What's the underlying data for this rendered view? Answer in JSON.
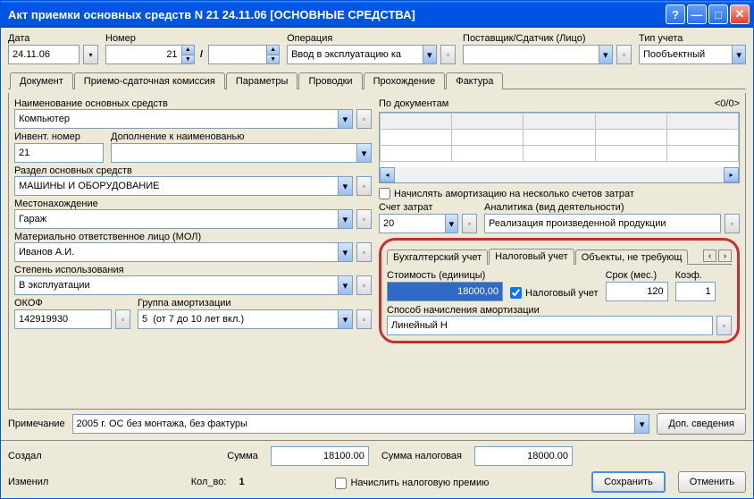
{
  "title": "Акт приемки основных средств N 21 24.11.06 [ОСНОВНЫЕ СРЕДСТВА]",
  "header": {
    "date": {
      "label": "Дата",
      "value": "24.11.06"
    },
    "number": {
      "label": "Номер",
      "value": "21",
      "sub": ""
    },
    "operation": {
      "label": "Операция",
      "value": "Ввод в эксплуатацию ка"
    },
    "supplier": {
      "label": "Поставщик/Сдатчик (Лицо)",
      "value": ""
    },
    "account_type": {
      "label": "Тип учета",
      "value": "Пообъектный"
    }
  },
  "tabs": [
    "Документ",
    "Приемо-сдаточная комиссия",
    "Параметры",
    "Проводки",
    "Прохождение",
    "Фактура"
  ],
  "active_tab": 0,
  "doc": {
    "name": {
      "label": "Наименование основных средств",
      "value": "Компьютер"
    },
    "inv": {
      "label": "Инвент. номер",
      "value": "21"
    },
    "name_add": {
      "label": "Дополнение к наименованью",
      "value": ""
    },
    "section": {
      "label": "Раздел основных средств",
      "value": "МАШИНЫ И ОБОРУДОВАНИЕ"
    },
    "location": {
      "label": "Местонахождение",
      "value": "Гараж"
    },
    "mol": {
      "label": "Материально ответственное лицо (МОЛ)",
      "value": "Иванов А.И."
    },
    "usage": {
      "label": "Степень использования",
      "value": "В эксплуатации"
    },
    "okof": {
      "label": "ОКОФ",
      "value": "142919930"
    },
    "amort_group": {
      "label": "Группа амортизации",
      "value": "5  (от 7 до 10 лет вкл.)"
    },
    "note": {
      "label": "Примечание",
      "value": "2005 г. ОС без монтажа, без фактуры"
    },
    "extra_button": "Доп. сведения"
  },
  "by_docs": {
    "label": "По документам",
    "pager": "<0/0>"
  },
  "amort_chk": "Начислять амортизацию на несколько счетов затрат",
  "expense": {
    "label": "Счет затрат",
    "value": "20"
  },
  "analytics": {
    "label": "Аналитика (вид деятельности)",
    "value": "Реализация произведенной продукции"
  },
  "inner_tabs": [
    "Бухгалтерский учет",
    "Налоговый учет",
    "Объекты, не требующ"
  ],
  "active_inner_tab": 1,
  "tax": {
    "cost": {
      "label": "Стоимость (единицы)",
      "value": "18000,00"
    },
    "checkbox": "Налоговый учет",
    "term": {
      "label": "Срок (мес.)",
      "value": "120"
    },
    "coef": {
      "label": "Коэф.",
      "value": "1"
    },
    "method": {
      "label": "Способ начисления амортизации",
      "value": "Линейный Н"
    }
  },
  "footer": {
    "created": "Создал",
    "modified": "Изменил",
    "sum": {
      "label": "Сумма",
      "value": "18100.00"
    },
    "sum_tax": {
      "label": "Сумма налоговая",
      "value": "18000.00"
    },
    "qty": {
      "label": "Кол_во:",
      "value": "1"
    },
    "tax_premium": "Начислить налоговую премию",
    "save": "Сохранить",
    "cancel": "Отменить"
  }
}
